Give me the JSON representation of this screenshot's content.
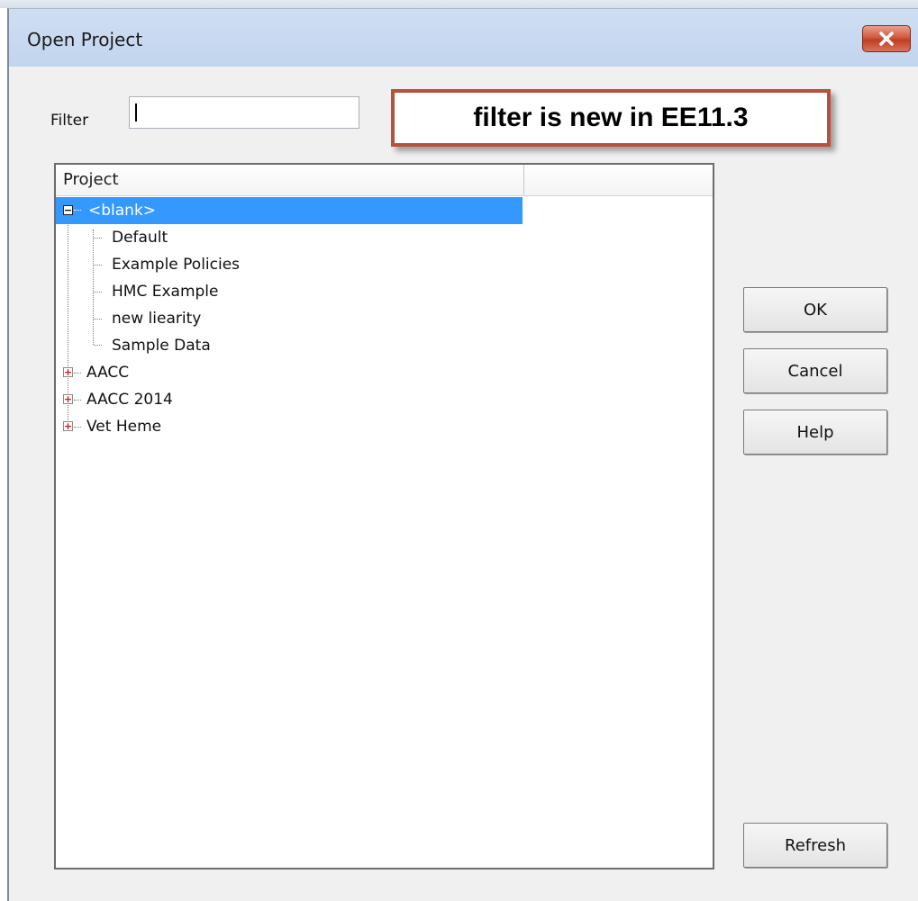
{
  "window": {
    "title": "Open Project",
    "close_icon": "close-icon",
    "close_color": "#c74326"
  },
  "filter": {
    "label": "Filter",
    "value": "",
    "placeholder": ""
  },
  "annotation": {
    "text": "filter is new in EE11.3",
    "border_color": "#b6513b"
  },
  "tree": {
    "column_header": "Project",
    "selection_color": "#3399ff",
    "items": [
      {
        "label": "<blank>",
        "expanded": true,
        "selected": true
      },
      {
        "label": "Default"
      },
      {
        "label": "Example Policies"
      },
      {
        "label": "HMC Example"
      },
      {
        "label": "new liearity"
      },
      {
        "label": "Sample Data"
      },
      {
        "label": "AACC",
        "expanded": false
      },
      {
        "label": "AACC 2014",
        "expanded": false
      },
      {
        "label": "Vet Heme",
        "expanded": false
      }
    ]
  },
  "buttons": {
    "ok": "OK",
    "cancel": "Cancel",
    "help": "Help",
    "refresh": "Refresh"
  }
}
